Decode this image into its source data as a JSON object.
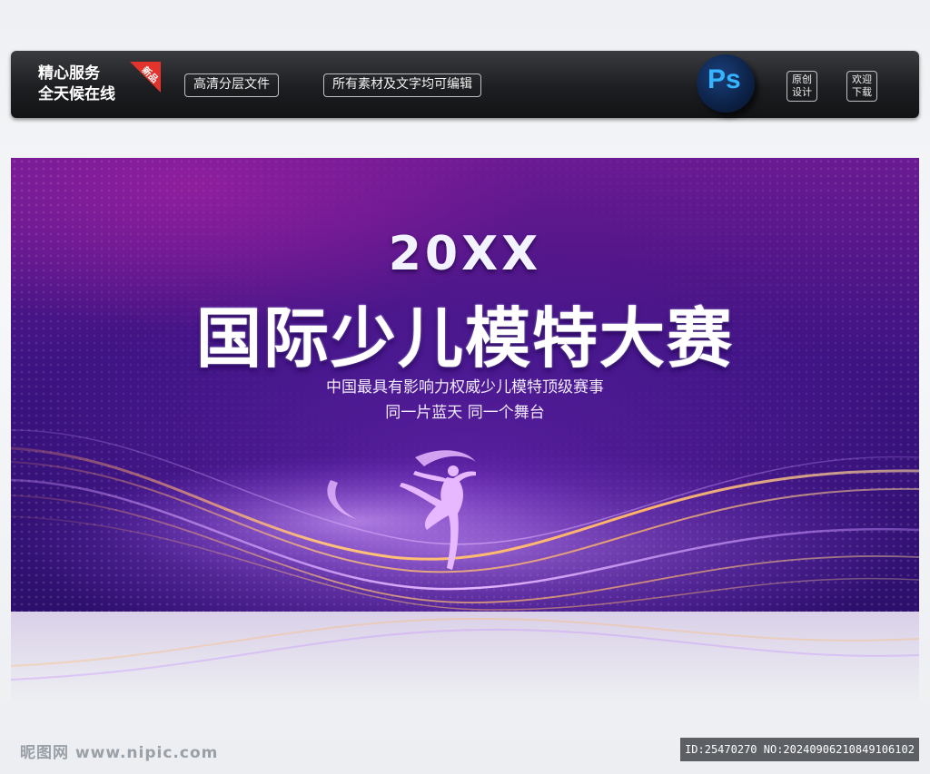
{
  "topbar": {
    "brand_line1": "精心服务",
    "brand_line2": "全天候在线",
    "ribbon_label": "新品",
    "tag1": "高清分层文件",
    "tag2": "所有素材及文字均可编辑",
    "ps_label": "Ps",
    "box1_line1": "原创",
    "box1_line2": "设计",
    "box2_line1": "欢迎",
    "box2_line2": "下载"
  },
  "banner": {
    "year": "20XX",
    "title": "国际少儿模特大赛",
    "subtitle1": "中国最具有影响力权威少儿模特顶级赛事",
    "subtitle2": "同一片蓝天 同一个舞台",
    "dancer_icon": "ballet-dancer-icon"
  },
  "footer": {
    "watermark": "昵图网 www.nipic.com",
    "id_text": "ID:25470270 NO:20240906210849106102"
  },
  "colors": {
    "banner_purple": "#3d1382",
    "accent_gold": "#ffb05a",
    "accent_violet": "#c58bff",
    "ps_blue": "#35b4ff",
    "ribbon_red": "#e2332d"
  }
}
